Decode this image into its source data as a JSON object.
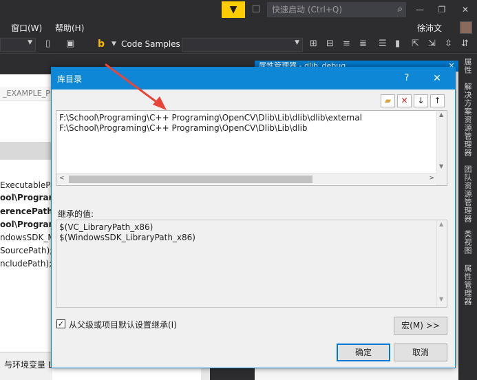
{
  "titlebar": {
    "quicklaunch_placeholder": "快速启动 (Ctrl+Q)",
    "icons": {
      "filter": "filter-icon",
      "feedback": "feedback-icon",
      "search": "search-icon"
    }
  },
  "menubar": {
    "items": [
      "窗口(W)",
      "帮助(H)"
    ],
    "user": "徐沛文"
  },
  "toolbar": {
    "code_samples": "Code Samples"
  },
  "background": {
    "tab_text": "_EXAMPLE_PR",
    "lines": [
      "ExecutablePa",
      "ool\\Program",
      "erencePath)",
      "ool\\Program",
      "ndowsSDK_Me",
      "SourcePath);",
      "ncludePath);\\"
    ],
    "bottom_text": "与环境变量 L"
  },
  "property_pane": {
    "title": "属性管理器 - dlib_debug"
  },
  "side_tabs": [
    "属性",
    "解决方案资源管理器",
    "团队资源管理器",
    "类视图",
    "属性管理器"
  ],
  "dialog": {
    "title": "库目录",
    "help": "?",
    "close": "✕",
    "list_items": [
      "F:\\School\\Programing\\C++ Programing\\OpenCV\\Dlib\\Lib\\dlib\\dlib\\external",
      "F:\\School\\Programing\\C++ Programing\\OpenCV\\Dlib\\Lib\\dlib"
    ],
    "inherited_label": "继承的值:",
    "inherited_items": [
      "$(VC_LibraryPath_x86)",
      "$(WindowsSDK_LibraryPath_x86)"
    ],
    "inherit_checkbox_label": "从父级或项目默认设置继承(I)",
    "inherit_checked": true,
    "macro_button": "宏(M) >>",
    "ok_button": "确定",
    "cancel_button": "取消"
  },
  "colors": {
    "accent": "#0e88d6",
    "ide_background": "#2d2d30",
    "arrow": "#e8443a",
    "filter_button": "#ffcc00"
  }
}
